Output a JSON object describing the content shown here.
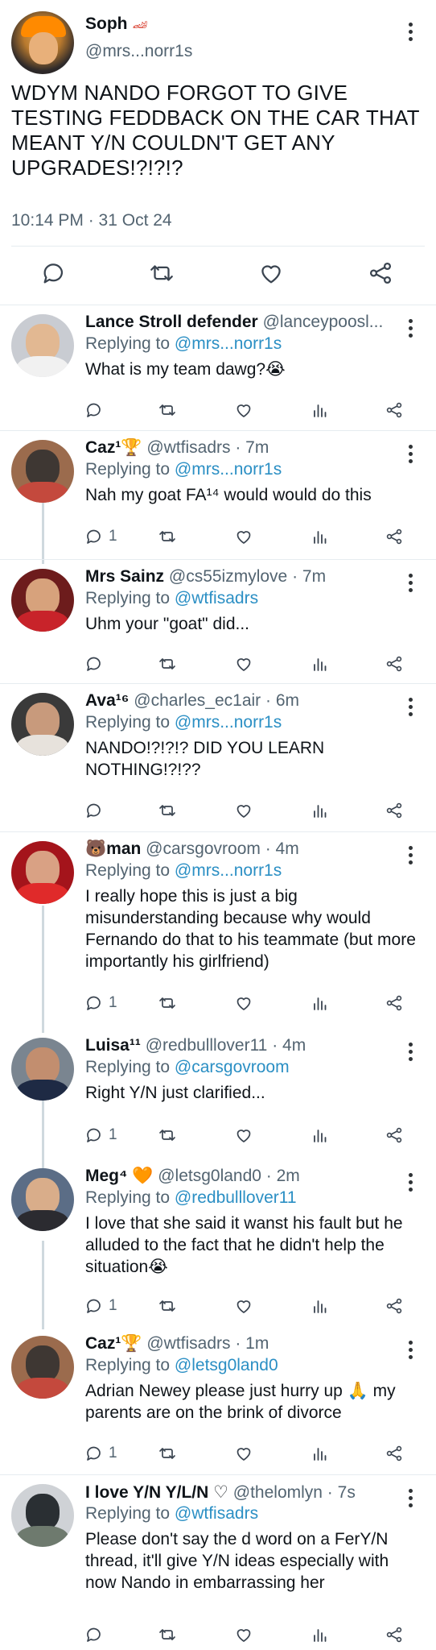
{
  "tweet": {
    "author_name": "Soph",
    "author_emoji": "🏎",
    "handle": "@mrs...norr1s",
    "text": "WDYM NANDO FORGOT TO GIVE TESTING FEDDBACK ON THE CAR THAT MEANT Y/N COULDN'T GET ANY UPGRADES!?!?!?",
    "timestamp": "10:14 PM · 31 Oct 24",
    "actions": [
      "reply-icon",
      "retweet-icon",
      "like-icon",
      "share-icon"
    ]
  },
  "colors": {
    "link": "#2b8fc4",
    "muted": "#536471",
    "text": "#0f1419",
    "divider": "#e6ecf0"
  },
  "replies": [
    {
      "name": "Lance Stroll defender",
      "handle": "@lanceypoosl...",
      "time": "",
      "replying_label": "Replying to",
      "replying_to": "@mrs...norr1s",
      "text": "What is my team dawg?😭",
      "reply_count": ""
    },
    {
      "name": "Caz¹🏆",
      "handle": "@wtfisadrs · 7m",
      "replying_label": "Replying to",
      "replying_to": "@mrs...norr1s",
      "text": "Nah my goat FA¹⁴ would would do this",
      "reply_count": "1"
    },
    {
      "name": "Mrs Sainz",
      "handle": "@cs55izmylove · 7m",
      "replying_label": "Replying to",
      "replying_to": "@wtfisadrs",
      "text": "Uhm your \"goat\" did...",
      "reply_count": ""
    },
    {
      "name": "Ava¹⁶",
      "handle": "@charles_ec1air · 6m",
      "replying_label": "Replying to",
      "replying_to": "@mrs...norr1s",
      "text": "NANDO!?!?!? DID YOU LEARN NOTHING!?!??",
      "reply_count": ""
    },
    {
      "name": "🐻man",
      "handle": "@carsgovroom · 4m",
      "replying_label": "Replying to",
      "replying_to": "@mrs...norr1s",
      "text": "I really hope this is just a big misunderstanding because why would Fernando do that to his teammate (but more importantly his girlfriend)",
      "reply_count": "1"
    },
    {
      "name": "Luisa¹¹",
      "handle": "@redbulllover11 · 4m",
      "replying_label": "Replying to",
      "replying_to": "@carsgovroom",
      "text": "Right Y/N just clarified...",
      "reply_count": "1"
    },
    {
      "name": "Meg⁴ 🧡",
      "handle": "@letsg0land0 · 2m",
      "replying_label": "Replying to",
      "replying_to": "@redbulllover11",
      "text": "I love that she said it wanst his fault but he alluded to the fact that he didn't help the situation😭",
      "reply_count": "1"
    },
    {
      "name": "Caz¹🏆",
      "handle": "@wtfisadrs · 1m",
      "replying_label": "Replying to",
      "replying_to": "@letsg0land0",
      "text": "Adrian Newey please just hurry up 🙏 my parents are on the brink of divorce",
      "reply_count": "1"
    },
    {
      "name": "I love Y/N Y/L/N ♡",
      "handle": "@thelomlyn · 7s",
      "replying_label": "Replying to",
      "replying_to": "@wtfisadrs",
      "text": "Please don't say the d word on a FerY/N thread, it'll give Y/N ideas especially with now Nando in embarrassing her",
      "reply_count": ""
    }
  ]
}
